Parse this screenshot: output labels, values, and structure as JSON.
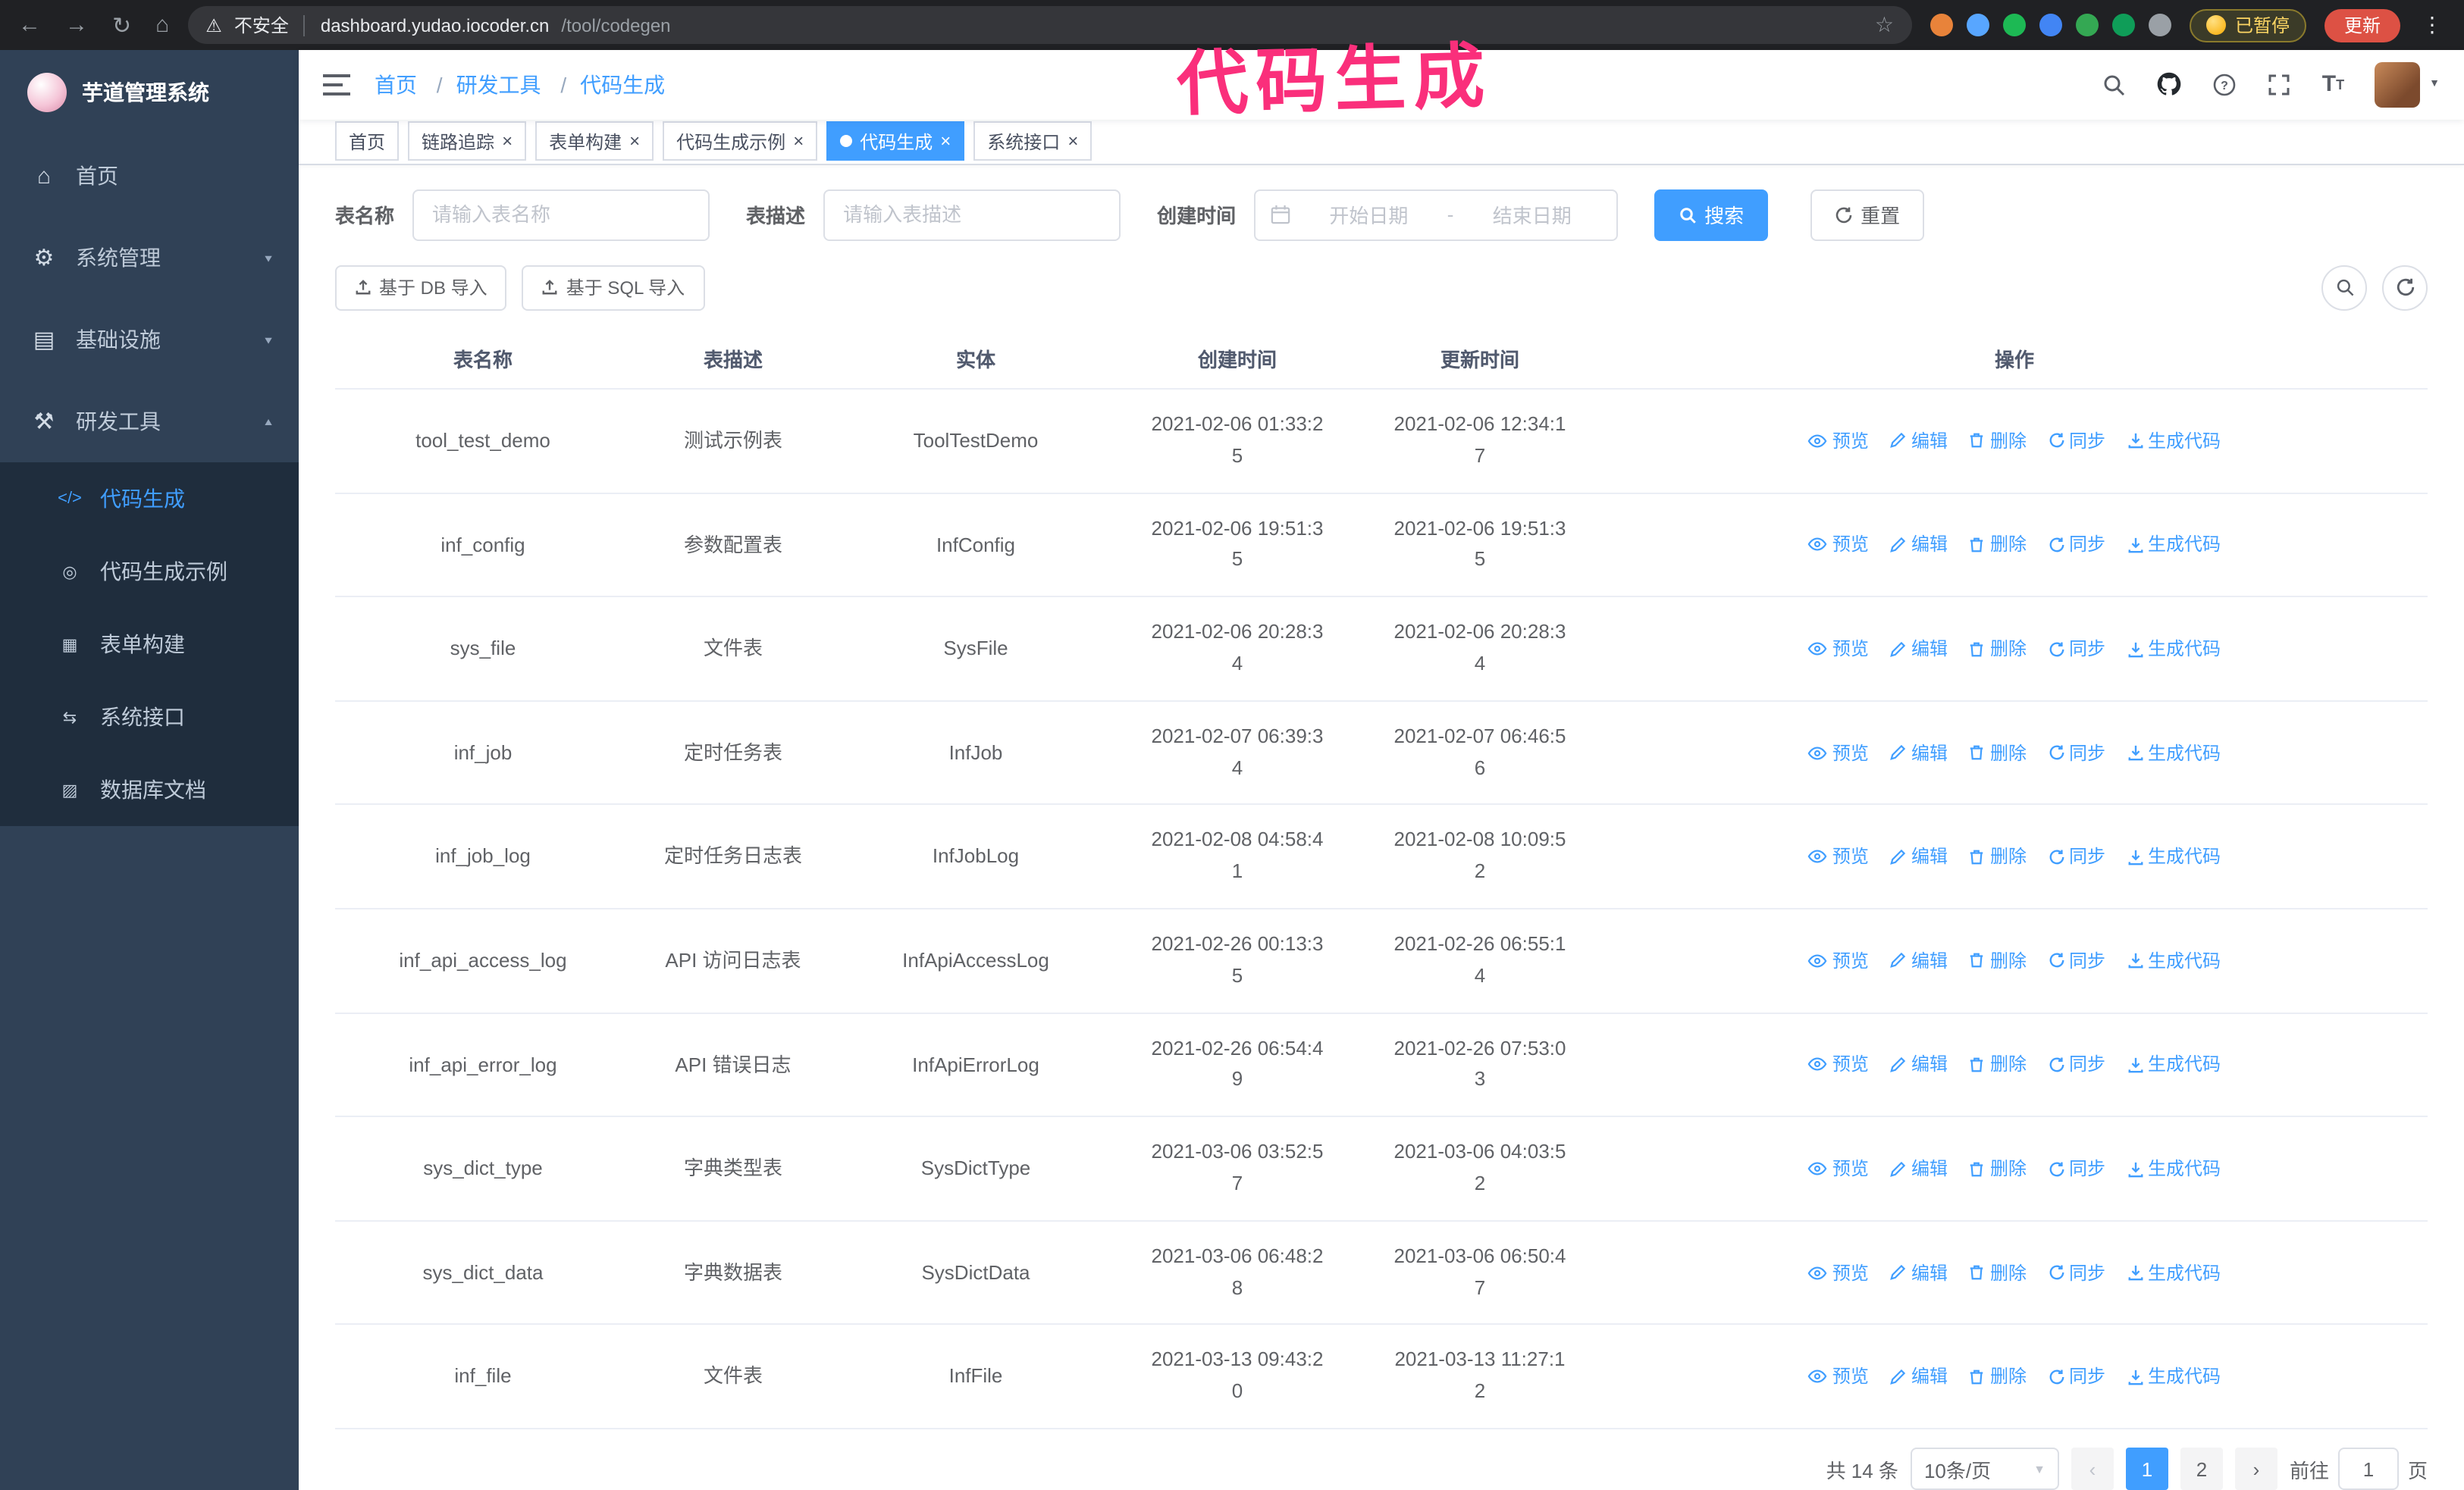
{
  "colors": {
    "primary": "#409eff",
    "sidebar_bg": "#304156",
    "submenu_bg": "#1f2d3d",
    "annotation": "#fa2f7b"
  },
  "annotation": {
    "text": "代码生成"
  },
  "browser": {
    "security_label": "不安全",
    "url_host": "dashboard.yudao.iocoder.cn",
    "url_path": "/tool/codegen",
    "paused_badge": "已暂停",
    "update_button": "更新",
    "extensions": [
      {
        "name": "extension-icon",
        "color": "#e8833a"
      },
      {
        "name": "extension-icon",
        "color": "#58a6ff"
      },
      {
        "name": "extension-icon",
        "color": "#1db954"
      },
      {
        "name": "extension-icon",
        "color": "#4285f4"
      },
      {
        "name": "extension-icon",
        "color": "#34a853"
      },
      {
        "name": "extension-icon",
        "color": "#0f9d58"
      },
      {
        "name": "extension-icon",
        "color": "#9aa0a6"
      }
    ]
  },
  "sidebar": {
    "logo_title": "芋道管理系统",
    "menu": [
      {
        "label": "首页",
        "icon": "⌂",
        "caret": ""
      },
      {
        "label": "系统管理",
        "icon": "⚙",
        "caret": "▼"
      },
      {
        "label": "基础设施",
        "icon": "▤",
        "caret": "▼"
      },
      {
        "label": "研发工具",
        "icon": "⚒",
        "caret": "▲"
      }
    ],
    "submenu": [
      {
        "label": "代码生成",
        "icon": "</>",
        "active": true
      },
      {
        "label": "代码生成示例",
        "icon": "◎",
        "active": false
      },
      {
        "label": "表单构建",
        "icon": "▦",
        "active": false
      },
      {
        "label": "系统接口",
        "icon": "⇆",
        "active": false
      },
      {
        "label": "数据库文档",
        "icon": "▨",
        "active": false
      }
    ]
  },
  "header": {
    "separator": "/",
    "breadcrumb": [
      {
        "label": "首页"
      },
      {
        "label": "研发工具"
      },
      {
        "label": "代码生成"
      }
    ]
  },
  "tabs": [
    {
      "label": "首页",
      "closable": false,
      "active": false
    },
    {
      "label": "链路追踪",
      "closable": true,
      "active": false
    },
    {
      "label": "表单构建",
      "closable": true,
      "active": false
    },
    {
      "label": "代码生成示例",
      "closable": true,
      "active": false
    },
    {
      "label": "代码生成",
      "closable": true,
      "active": true
    },
    {
      "label": "系统接口",
      "closable": true,
      "active": false
    }
  ],
  "filters": {
    "name_label": "表名称",
    "name_placeholder": "请输入表名称",
    "desc_label": "表描述",
    "desc_placeholder": "请输入表描述",
    "time_label": "创建时间",
    "date_start": "开始日期",
    "date_separator": "-",
    "date_end": "结束日期",
    "search_button": "搜索",
    "reset_button": "重置"
  },
  "toolbar": {
    "import_db": "基于 DB 导入",
    "import_sql": "基于 SQL 导入"
  },
  "table": {
    "columns": [
      "表名称",
      "表描述",
      "实体",
      "创建时间",
      "更新时间",
      "操作"
    ],
    "actions": [
      "预览",
      "编辑",
      "删除",
      "同步",
      "生成代码"
    ],
    "rows": [
      {
        "name": "tool_test_demo",
        "desc": "测试示例表",
        "entity": "ToolTestDemo",
        "created": "2021-02-06 01:33:25",
        "updated": "2021-02-06 12:34:17"
      },
      {
        "name": "inf_config",
        "desc": "参数配置表",
        "entity": "InfConfig",
        "created": "2021-02-06 19:51:35",
        "updated": "2021-02-06 19:51:35"
      },
      {
        "name": "sys_file",
        "desc": "文件表",
        "entity": "SysFile",
        "created": "2021-02-06 20:28:34",
        "updated": "2021-02-06 20:28:34"
      },
      {
        "name": "inf_job",
        "desc": "定时任务表",
        "entity": "InfJob",
        "created": "2021-02-07 06:39:34",
        "updated": "2021-02-07 06:46:56"
      },
      {
        "name": "inf_job_log",
        "desc": "定时任务日志表",
        "entity": "InfJobLog",
        "created": "2021-02-08 04:58:41",
        "updated": "2021-02-08 10:09:52"
      },
      {
        "name": "inf_api_access_log",
        "desc": "API 访问日志表",
        "entity": "InfApiAccessLog",
        "created": "2021-02-26 00:13:35",
        "updated": "2021-02-26 06:55:14"
      },
      {
        "name": "inf_api_error_log",
        "desc": "API 错误日志",
        "entity": "InfApiErrorLog",
        "created": "2021-02-26 06:54:49",
        "updated": "2021-02-26 07:53:03"
      },
      {
        "name": "sys_dict_type",
        "desc": "字典类型表",
        "entity": "SysDictType",
        "created": "2021-03-06 03:52:57",
        "updated": "2021-03-06 04:03:52"
      },
      {
        "name": "sys_dict_data",
        "desc": "字典数据表",
        "entity": "SysDictData",
        "created": "2021-03-06 06:48:28",
        "updated": "2021-03-06 06:50:47"
      },
      {
        "name": "inf_file",
        "desc": "文件表",
        "entity": "InfFile",
        "created": "2021-03-13 09:43:20",
        "updated": "2021-03-13 11:27:12"
      }
    ]
  },
  "pagination": {
    "total": "共 14 条",
    "page_size": "10条/页",
    "pages": [
      {
        "label": "1",
        "active": true
      },
      {
        "label": "2",
        "active": false
      }
    ],
    "goto_label": "前往",
    "goto_value": "1",
    "goto_unit": "页"
  }
}
